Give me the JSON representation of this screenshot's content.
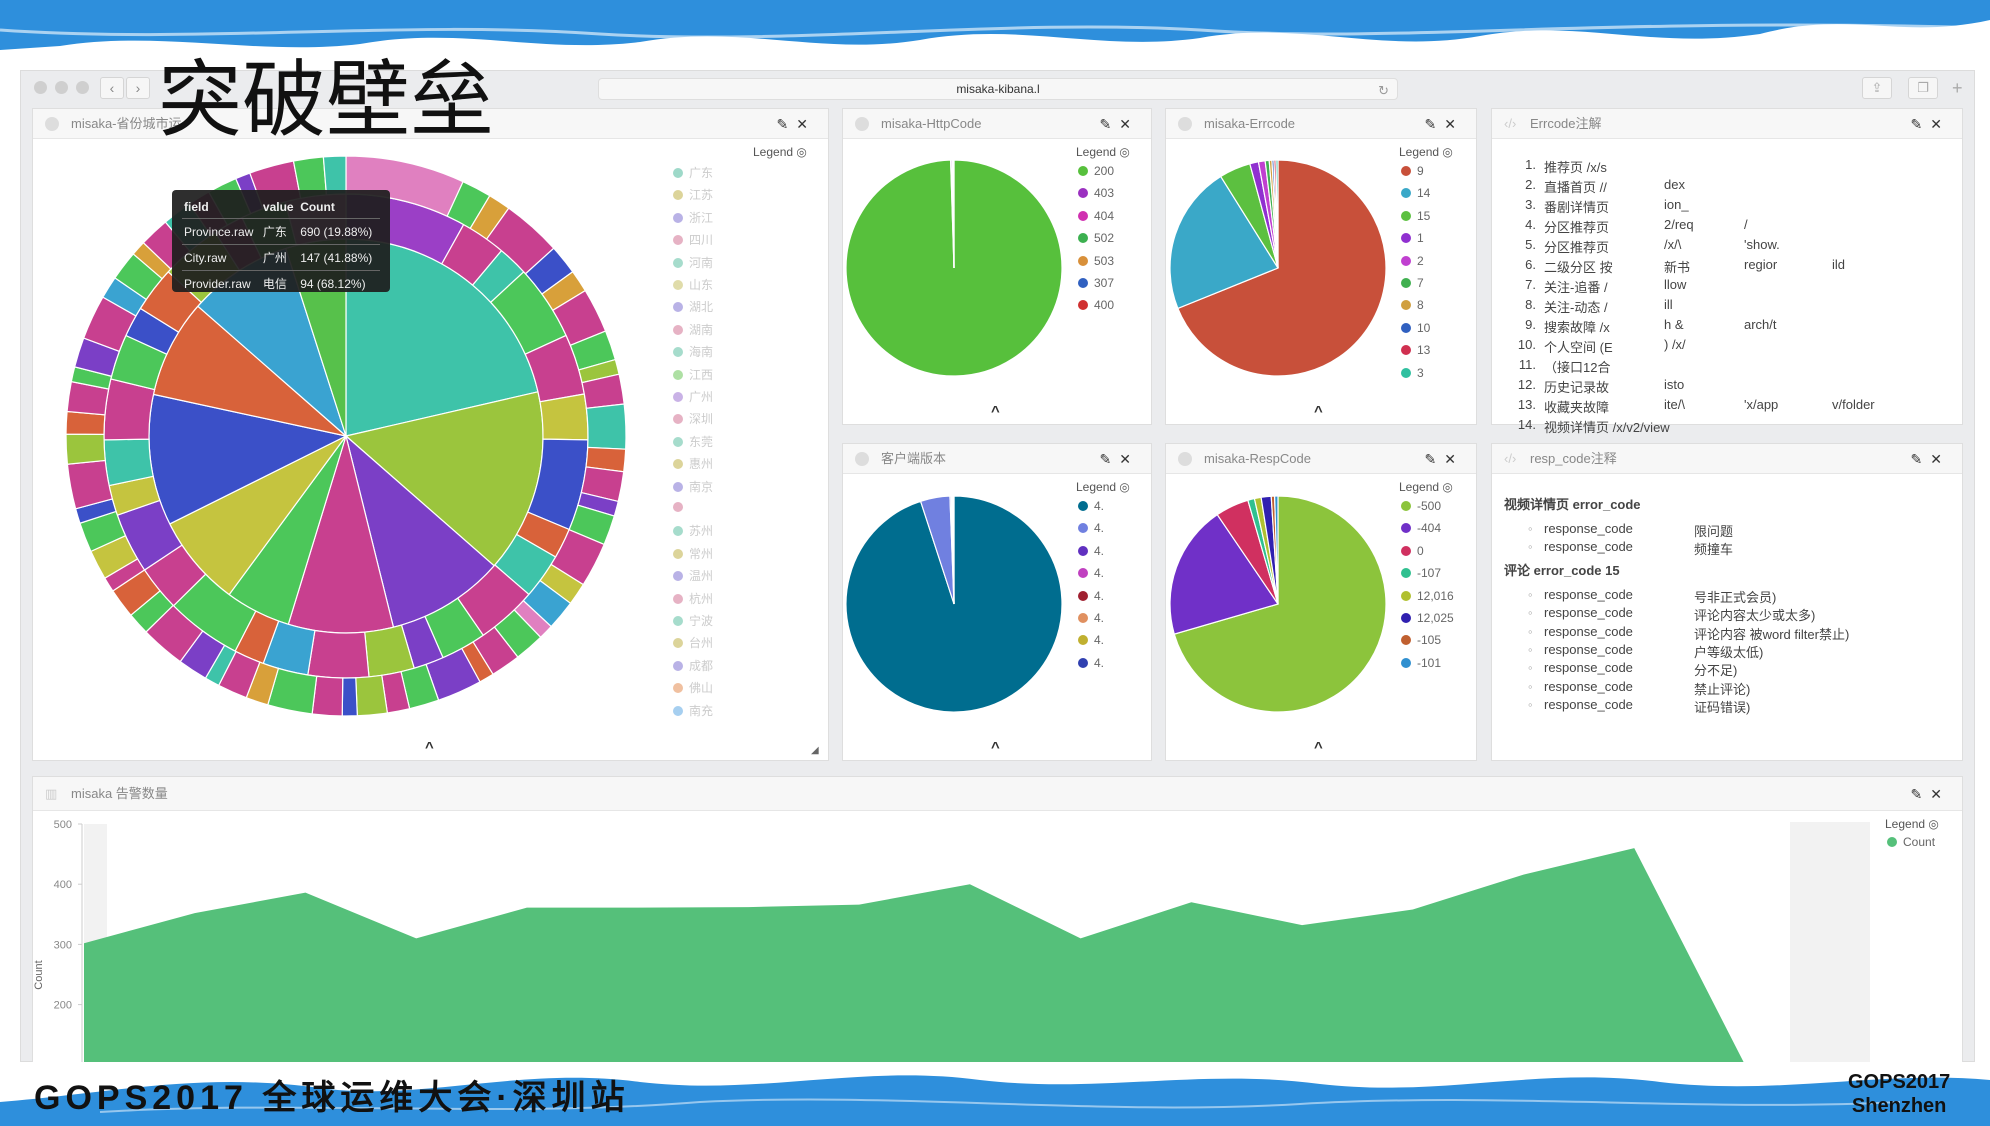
{
  "slide_title": "突破壁垒",
  "browser": {
    "url": "misaka-kibana.l",
    "back": "‹",
    "forward": "›",
    "reload_icon": "reload-icon",
    "share_icon": "share-icon",
    "tabs_icon": "tabs-icon",
    "new_tab": "+"
  },
  "panels": {
    "province": {
      "title": "misaka-省份城市运",
      "legend_label": "Legend",
      "collapse": "^",
      "legend": [
        "广东",
        "江苏",
        "浙江",
        "四川",
        "河南",
        "山东",
        "湖北",
        "湖南",
        "海南",
        "江西",
        "广州",
        "深圳",
        "东莞",
        "惠州",
        "南京",
        "",
        "苏州",
        "常州",
        "温州",
        "杭州",
        "宁波",
        "台州",
        "成都",
        "佛山",
        "南充"
      ],
      "tooltip": {
        "headers": [
          "field",
          "value",
          "Count"
        ],
        "rows": [
          [
            "Province.raw",
            "广东",
            "690 (19.88%)"
          ],
          [
            "City.raw",
            "广州",
            "147 (41.88%)"
          ],
          [
            "Provider.raw",
            "电信",
            "94 (68.12%)"
          ]
        ]
      }
    },
    "httpcode": {
      "title": "misaka-HttpCode",
      "legend_label": "Legend",
      "collapse": "^"
    },
    "errcode": {
      "title": "misaka-Errcode",
      "legend_label": "Legend",
      "collapse": "^"
    },
    "client": {
      "title": "客户端版本",
      "legend_label": "Legend"
    },
    "respcode": {
      "title": "misaka-RespCode",
      "legend_label": "Legend"
    },
    "errcode_notes": {
      "title": "Errcode注解",
      "items": [
        [
          "1.",
          "推荐页 /x/s",
          "",
          "",
          ""
        ],
        [
          "2.",
          "直播首页 //",
          "dex",
          "",
          ""
        ],
        [
          "3.",
          "番剧详情页",
          "ion_",
          "",
          ""
        ],
        [
          "4.",
          "分区推荐页",
          "2/req",
          "/",
          ""
        ],
        [
          "5.",
          "分区推荐页",
          "/x/\\",
          "'show.",
          ""
        ],
        [
          "6.",
          "二级分区 按",
          "新书",
          "regior",
          "ild"
        ],
        [
          "7.",
          "关注-追番 /",
          "llow",
          "",
          ""
        ],
        [
          "8.",
          "关注-动态 /",
          "ill",
          "",
          ""
        ],
        [
          "9.",
          "搜索故障 /x",
          "h &",
          "arch/t",
          ""
        ],
        [
          "10.",
          "个人空间 (E",
          ") /x/",
          "",
          ""
        ],
        [
          "11.",
          "（接口12合",
          "",
          "",
          ""
        ],
        [
          "12.",
          "历史记录故",
          "isto",
          "",
          ""
        ],
        [
          "13.",
          "收藏夹故障",
          "ite/\\",
          "'x/app",
          "v/folder"
        ],
        [
          "14.",
          "视频详情页 /x/v2/view",
          "",
          "",
          ""
        ]
      ]
    },
    "resp_notes": {
      "title": "resp_code注释",
      "sections": [
        {
          "heading": "视频详情页 error_code",
          "items": [
            [
              "response_code",
              "限问题"
            ],
            [
              "response_code",
              "频撞车"
            ]
          ]
        },
        {
          "heading": "评论 error_code 15",
          "items": [
            [
              "response_code",
              "号非正式会员)"
            ],
            [
              "response_code",
              "评论内容太少或太多)"
            ],
            [
              "response_code",
              "评论内容 被word filter禁止)"
            ],
            [
              "response_code",
              "户等级太低)"
            ],
            [
              "response_code",
              "分不足)"
            ],
            [
              "response_code",
              "禁止评论)"
            ],
            [
              "response_code",
              "证码错误)"
            ]
          ]
        }
      ]
    },
    "alerts": {
      "title": "misaka 告警数量",
      "legend_label": "Legend"
    }
  },
  "chart_data": [
    {
      "type": "pie",
      "name": "sunburst",
      "rings": [
        {
          "values": [
            19.9,
            14,
            9,
            8,
            5,
            7,
            10,
            7.5,
            8,
            4.6
          ],
          "colors": [
            "#3ec3a9",
            "#9bc53d",
            "#7b3fc6",
            "#c8408f",
            "#4cc75a",
            "#c5c43f",
            "#3b50c8",
            "#d8623a",
            "#3aa3d1",
            "#57c14b"
          ]
        },
        {
          "values": [
            8,
            3,
            2,
            5,
            4,
            3,
            6,
            2,
            3,
            4,
            3,
            2,
            3,
            4,
            3,
            2,
            5,
            3,
            4,
            2,
            3,
            4,
            3,
            2,
            3,
            4,
            2,
            3,
            4
          ],
          "colors": [
            "#9b3fc6",
            "#c8408f",
            "#3ec3a9",
            "#4cc75a",
            "#c8408f",
            "#c5c43f",
            "#3b50c8",
            "#d8623a",
            "#3ec3a9",
            "#c8408f",
            "#4cc75a",
            "#7b3fc6",
            "#9bc53d",
            "#c8408f",
            "#3aa3d1",
            "#d8623a",
            "#4cc75a",
            "#c8408f",
            "#7b3fc6",
            "#c5c43f",
            "#3ec3a9",
            "#c8408f",
            "#4cc75a",
            "#3b50c8",
            "#d8623a",
            "#9bc53d",
            "#c8408f",
            "#4cc75a",
            "#e080c0"
          ]
        },
        {
          "values": [
            8,
            2,
            1.5,
            4,
            2,
            1.5,
            3,
            2,
            1,
            2,
            3,
            1.5,
            2,
            1,
            2,
            3,
            1.5,
            2,
            1,
            2,
            2,
            1,
            3,
            2,
            1.5,
            2,
            1,
            2,
            3,
            1.5,
            2,
            1,
            2,
            3,
            1.5,
            2,
            1,
            2,
            2,
            1,
            3,
            2,
            1.5,
            2,
            1,
            2,
            3,
            1.5,
            2,
            1,
            2,
            2,
            1.5,
            2,
            1,
            3,
            2,
            1.5
          ],
          "colors": [
            "#e080c0",
            "#4cc75a",
            "#d8a03a",
            "#c8408f",
            "#3b50c8",
            "#d8a03a",
            "#c8408f",
            "#4cc75a",
            "#9bc53d",
            "#c8408f",
            "#3ec3a9",
            "#d8623a",
            "#c8408f",
            "#7b3fc6",
            "#4cc75a",
            "#c8408f",
            "#c5c43f",
            "#3aa3d1",
            "#e080c0",
            "#4cc75a",
            "#c8408f",
            "#d8623a",
            "#7b3fc6",
            "#4cc75a",
            "#c8408f",
            "#9bc53d",
            "#3b50c8",
            "#c8408f",
            "#4cc75a",
            "#d8a03a",
            "#c8408f",
            "#3ec3a9",
            "#7b3fc6",
            "#c8408f",
            "#4cc75a",
            "#d8623a",
            "#c8408f",
            "#c5c43f",
            "#4cc75a",
            "#3b50c8",
            "#c8408f",
            "#9bc53d",
            "#d8623a",
            "#c8408f",
            "#4cc75a",
            "#7b3fc6",
            "#c8408f",
            "#3aa3d1",
            "#4cc75a",
            "#d8a03a",
            "#c8408f",
            "#3ec3a9",
            "#c8408f",
            "#4cc75a",
            "#7b3fc6",
            "#c8408f",
            "#4cc75a",
            "#3ec3a9"
          ]
        }
      ]
    },
    {
      "type": "pie",
      "name": "httpcode",
      "labels": [
        "200",
        "403",
        "404",
        "502",
        "503",
        "307",
        "400"
      ],
      "values": [
        99.5,
        0.2,
        0.1,
        0.1,
        0.05,
        0.03,
        0.02
      ],
      "colors": [
        "#57c03c",
        "#9b30c0",
        "#d030b0",
        "#3cb050",
        "#d8903a",
        "#3060c0",
        "#d03030"
      ]
    },
    {
      "type": "pie",
      "name": "errcode",
      "labels": [
        "9",
        "14",
        "15",
        "1",
        "2",
        "7",
        "8",
        "10",
        "13",
        "3"
      ],
      "values": [
        68.9,
        22.2,
        4.7,
        1.3,
        1,
        0.6,
        0.4,
        0.3,
        0.3,
        0.3
      ],
      "colors": [
        "#c8503a",
        "#3aa8c8",
        "#5cc040",
        "#9030d0",
        "#c040d0",
        "#40b050",
        "#d0a040",
        "#3060c0",
        "#d03050",
        "#30c0a0"
      ]
    },
    {
      "type": "pie",
      "name": "client",
      "labels": [
        "4.",
        "4.",
        "4.",
        "4.",
        "4.",
        "4.",
        "4.",
        "4."
      ],
      "values": [
        95,
        4.4,
        0.2,
        0.1,
        0.1,
        0.1,
        0.05,
        0.05
      ],
      "colors": [
        "#006d8f",
        "#7080e0",
        "#6030c0",
        "#c040c0",
        "#a02030",
        "#e09060",
        "#c0b030",
        "#3040b0"
      ]
    },
    {
      "type": "pie",
      "name": "respcode",
      "labels": [
        "-500",
        "-404",
        "0",
        "-107",
        "12,016",
        "12,025",
        "-105",
        "-101"
      ],
      "values": [
        70.5,
        20,
        5,
        1,
        1,
        1.5,
        0.5,
        0.5
      ],
      "colors": [
        "#8cc43c",
        "#7030c8",
        "#d03060",
        "#30c090",
        "#b0c030",
        "#3020b0",
        "#c06030",
        "#3090d0"
      ]
    },
    {
      "type": "area",
      "name": "alerts",
      "series": [
        {
          "name": "Count",
          "values": [
            302,
            352,
            386,
            310,
            361,
            361,
            362,
            366,
            400,
            310,
            370,
            332,
            358,
            416,
            460,
            100
          ],
          "color": "#55c07a"
        }
      ],
      "ylabel": "Count",
      "yticks": [
        500,
        400,
        300,
        200
      ],
      "ylim": [
        100,
        500
      ]
    }
  ],
  "footer": {
    "text": "GOPS2017 全球运维大会·深圳站",
    "right_line1": "GOPS2017",
    "right_line2": "Shenzhen"
  }
}
